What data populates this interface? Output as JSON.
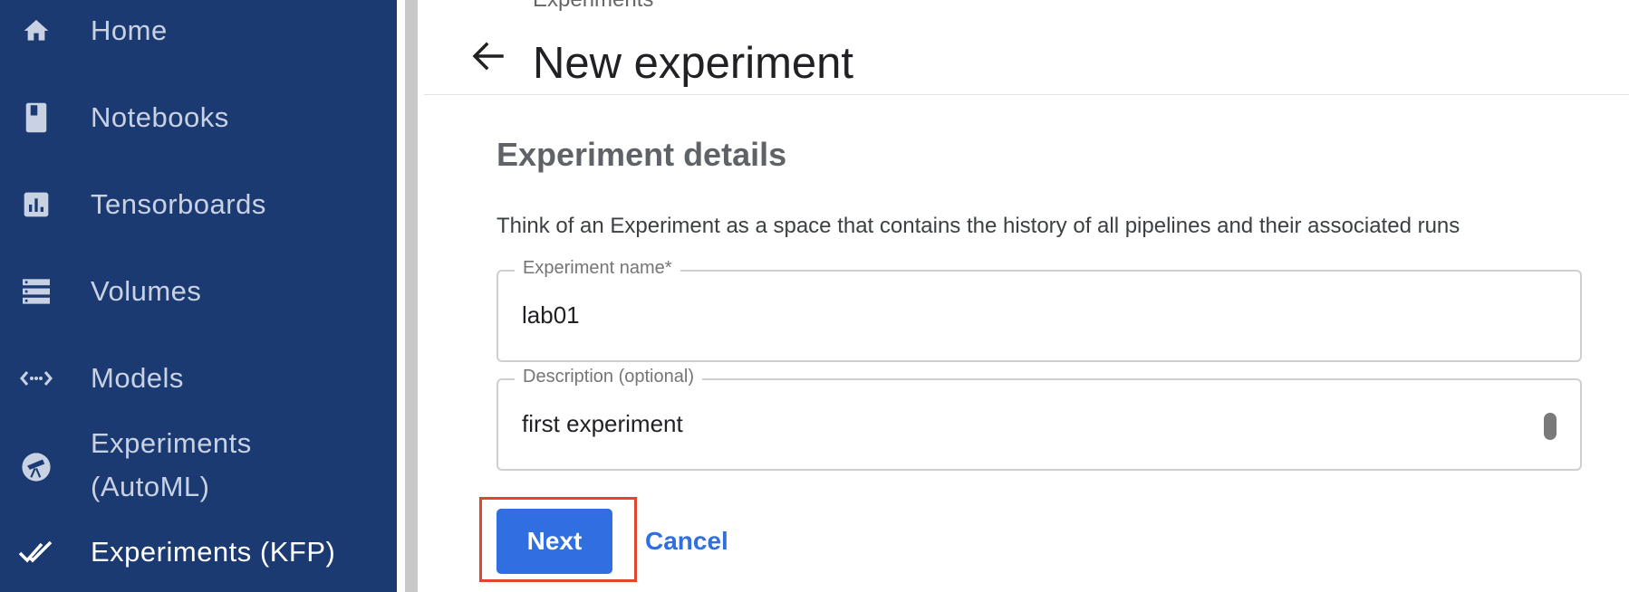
{
  "sidebar": {
    "items": [
      {
        "label": "Home",
        "icon": "home-icon"
      },
      {
        "label": "Notebooks",
        "icon": "notebook-icon"
      },
      {
        "label": "Tensorboards",
        "icon": "chart-icon"
      },
      {
        "label": "Volumes",
        "icon": "storage-icon"
      },
      {
        "label": "Models",
        "icon": "code-arrows-icon"
      },
      {
        "label_line1": "Experiments",
        "label_line2": "(AutoML)",
        "icon": "telescope-icon"
      },
      {
        "label": "Experiments (KFP)",
        "icon": "double-check-icon",
        "active": true
      }
    ]
  },
  "header": {
    "breadcrumb": "Experiments",
    "title": "New experiment"
  },
  "form": {
    "section_title": "Experiment details",
    "description_text": "Think of an Experiment as a space that contains the history of all pipelines and their associated runs",
    "name_field": {
      "label": "Experiment name*",
      "value": "lab01"
    },
    "description_field": {
      "label": "Description (optional)",
      "value": "first experiment"
    },
    "next_label": "Next",
    "cancel_label": "Cancel"
  },
  "colors": {
    "sidebar_bg": "#1c3a72",
    "accent": "#2f6fe0",
    "highlight": "#e1452c"
  }
}
